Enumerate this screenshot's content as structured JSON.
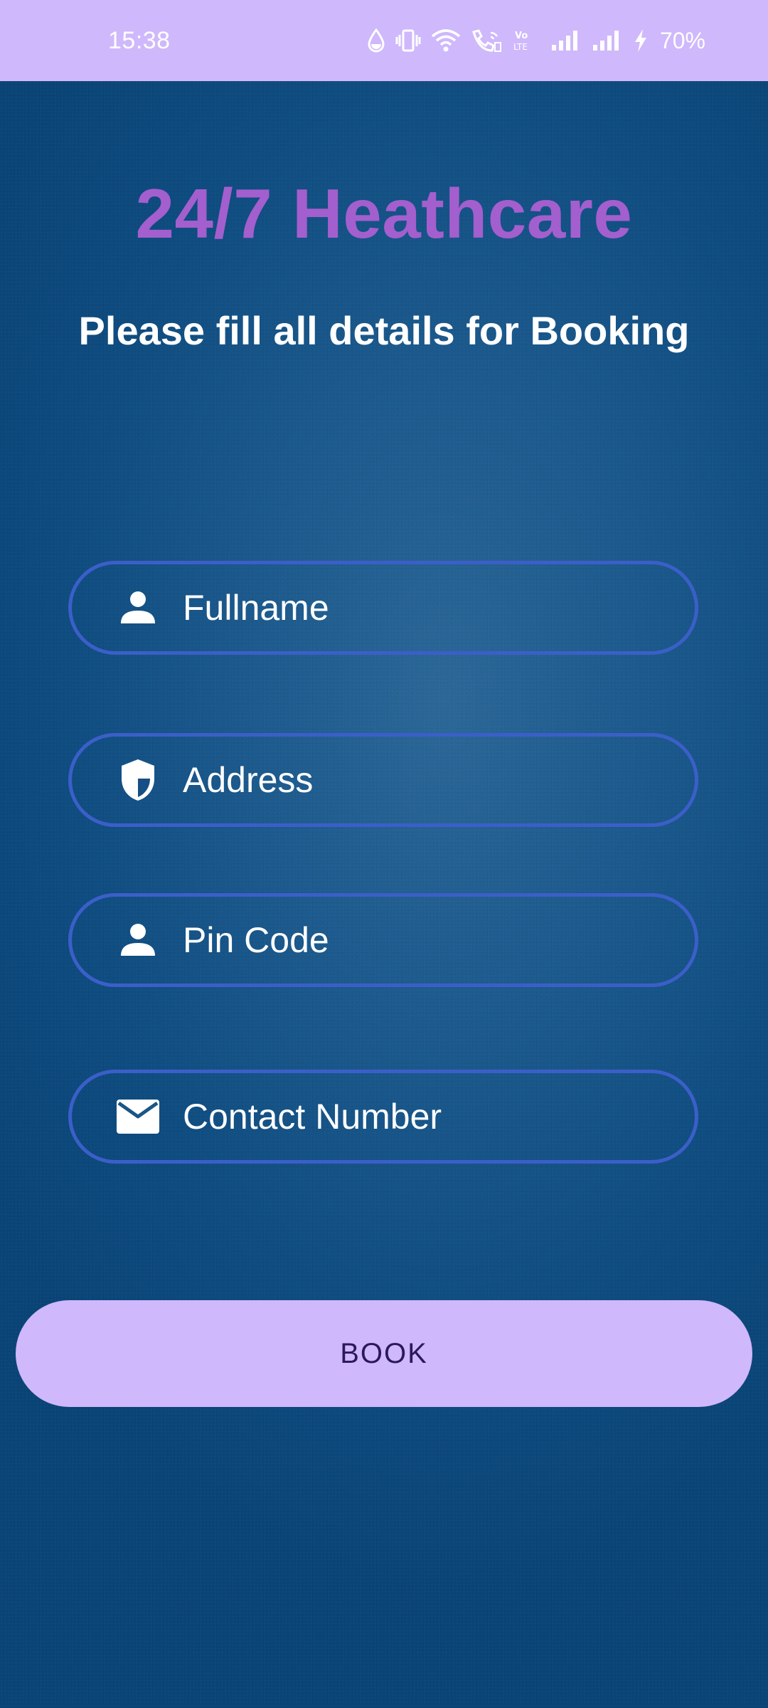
{
  "status_bar": {
    "time": "15:38",
    "battery": "70%",
    "icons": [
      "water-drop-icon",
      "vibrate-icon",
      "wifi-icon",
      "wifi-calling-icon",
      "volte-icon",
      "signal-1-icon",
      "signal-2-icon",
      "charging-bolt-icon"
    ]
  },
  "header": {
    "title": "24/7 Heathcare",
    "subtitle": "Please fill all details for Booking"
  },
  "form": {
    "fullname": {
      "placeholder": "Fullname",
      "icon": "person-icon"
    },
    "address": {
      "placeholder": "Address",
      "icon": "shield-icon"
    },
    "pincode": {
      "placeholder": "Pin Code",
      "icon": "person-icon"
    },
    "contact": {
      "placeholder": "Contact Number",
      "icon": "mail-icon"
    },
    "book_label": "BOOK"
  },
  "colors": {
    "status_bar": "#cfb8fb",
    "title": "#a35fcd",
    "field_border": "#3b5fc9",
    "button": "#cfb8fb",
    "button_text": "#2b1a5a"
  }
}
